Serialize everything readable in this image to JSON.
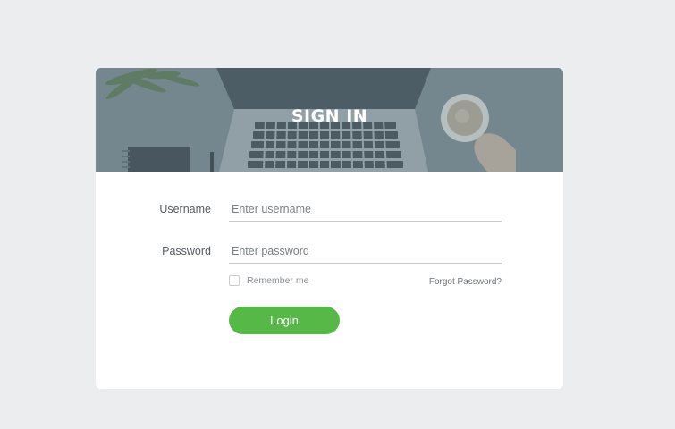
{
  "header": {
    "title": "SIGN IN"
  },
  "form": {
    "username_label": "Username",
    "username_placeholder": "Enter username",
    "username_value": "",
    "password_label": "Password",
    "password_placeholder": "Enter password",
    "password_value": "",
    "remember_label": "Remember me",
    "remember_checked": false,
    "forgot_label": "Forgot Password?",
    "login_label": "Login"
  },
  "colors": {
    "page_background": "#ebedee",
    "card_background": "#ffffff",
    "login_button": "#56b947",
    "hero_overlay": "#6b7f87"
  }
}
